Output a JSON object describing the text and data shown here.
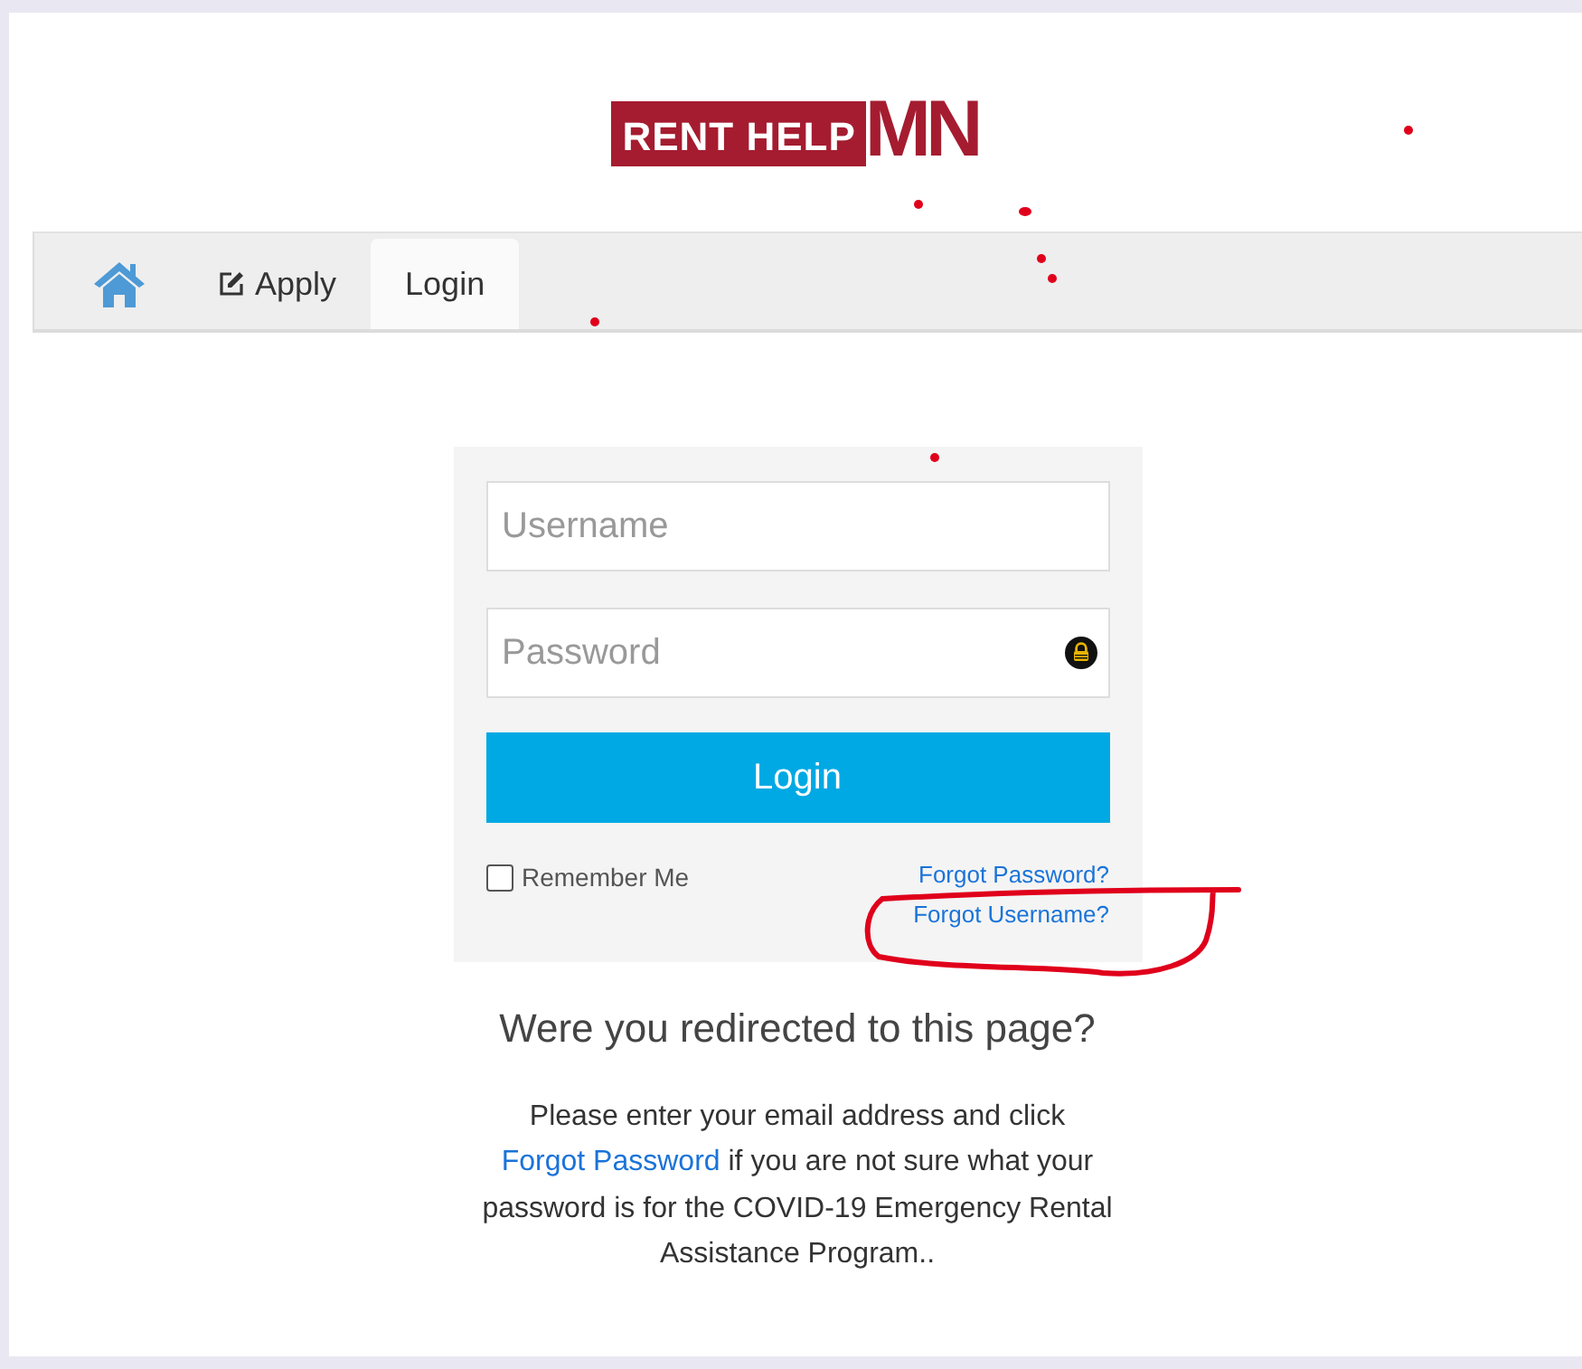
{
  "logo": {
    "boxed_text": "RENT HELP",
    "trailing_text": "MN"
  },
  "nav": {
    "tabs": [
      {
        "kind": "home",
        "selected": false
      },
      {
        "kind": "apply",
        "label": "Apply",
        "selected": false
      },
      {
        "kind": "plain",
        "label": "Login",
        "selected": true
      }
    ]
  },
  "login_form": {
    "username": {
      "placeholder": "Username"
    },
    "password": {
      "placeholder": "Password"
    },
    "submit": "Login",
    "remember": {
      "label": "Remember Me",
      "checked": false
    },
    "links": [
      "Forgot Password?",
      "Forgot Username?"
    ]
  },
  "redirect_notice": {
    "heading": "Were you redirected to this page?",
    "text_before": "Please enter your email address and click",
    "link": "Forgot Password",
    "text_after": "if you are not sure what your password is for the COVID-19 Emergency Rental Assistance Program.."
  }
}
